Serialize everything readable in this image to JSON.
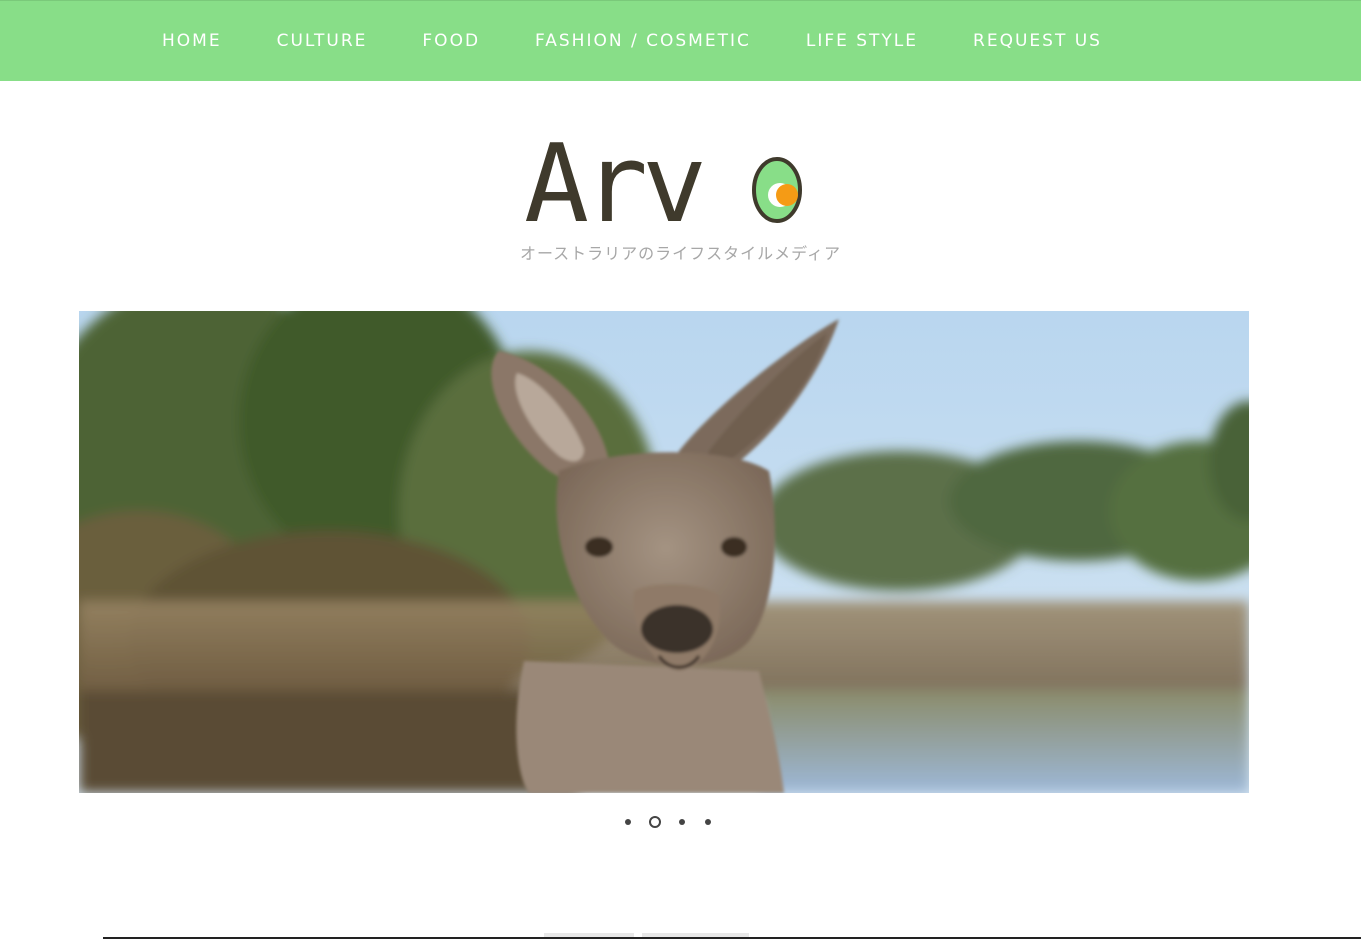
{
  "nav": {
    "items": [
      {
        "label": "HOME"
      },
      {
        "label": "CULTURE"
      },
      {
        "label": "FOOD"
      },
      {
        "label": "FASHION / COSMETIC"
      },
      {
        "label": "LIFE STYLE"
      },
      {
        "label": "REQUEST US"
      }
    ]
  },
  "logo": {
    "text": "Arv",
    "icon": "avocado-o-icon"
  },
  "tagline": "オーストラリアのライフスタイルメディア",
  "carousel": {
    "slide_count": 4,
    "active_index": 1,
    "image": "kangaroo-photo"
  },
  "colors": {
    "nav_bg": "#88de88",
    "logo_text": "#3f3a2c",
    "avocado_green": "#88de88",
    "avocado_pit": "#f59b15"
  }
}
